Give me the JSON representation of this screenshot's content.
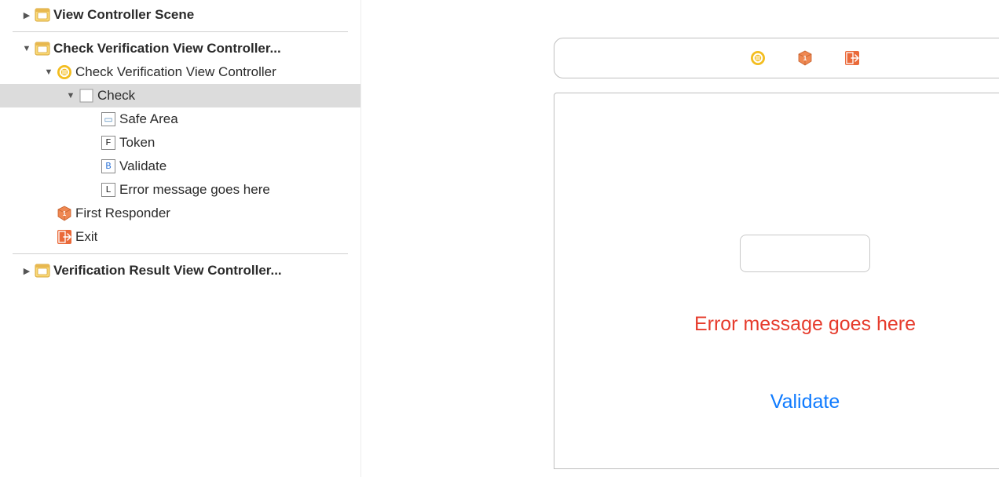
{
  "outline": {
    "scene1": {
      "label": "View Controller Scene",
      "expanded": false
    },
    "scene2": {
      "label": "Check Verification View Controller...",
      "expanded": true,
      "vc": {
        "label": "Check Verification View Controller",
        "expanded": true,
        "view": {
          "label": "Check",
          "expanded": true,
          "selected": true,
          "children": {
            "safeArea": {
              "label": "Safe Area",
              "glyph": "▭"
            },
            "token": {
              "label": "Token",
              "glyph": "F"
            },
            "validate": {
              "label": "Validate",
              "glyph": "B"
            },
            "error": {
              "label": "Error message goes here",
              "glyph": "L"
            }
          }
        }
      },
      "firstResponder": {
        "label": "First Responder"
      },
      "exit": {
        "label": "Exit"
      }
    },
    "scene3": {
      "label": "Verification Result View Controller...",
      "expanded": false
    }
  },
  "canvas": {
    "token_placeholder": "",
    "error_text": "Error message goes here",
    "validate_label": "Validate"
  },
  "colors": {
    "storyboard_yellow": "#f2b42a",
    "viewcontroller_yellow": "#f3bd1f",
    "first_responder_orange": "#e8723c",
    "exit_orange": "#ea6a3a",
    "error_red": "#e63b2c",
    "link_blue": "#0f7bff"
  }
}
